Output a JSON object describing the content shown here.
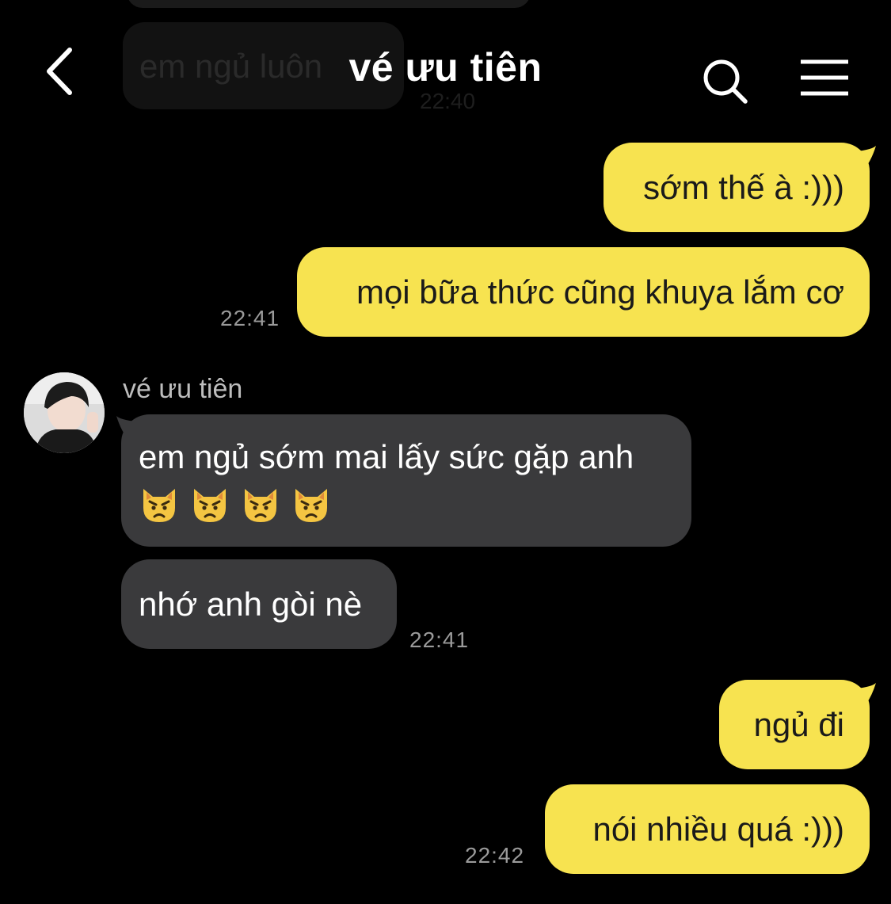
{
  "header": {
    "title": "vé ưu tiên",
    "back_icon": "chevron-left-icon",
    "search_icon": "search-icon",
    "menu_icon": "hamburger-menu-icon"
  },
  "ghost": {
    "text": "em ngủ luôn",
    "time": "22:40"
  },
  "contact": {
    "name": "vé ưu tiên"
  },
  "colors": {
    "mine_bubble": "#f7e350",
    "theirs_bubble": "#3a3a3c",
    "background": "#000000",
    "timestamp": "#9a9a9a"
  },
  "messages": [
    {
      "from": "me",
      "text": "sớm thế à :)))"
    },
    {
      "from": "me",
      "text": "mọi bữa thức cũng khuya lắm cơ",
      "time": "22:41"
    },
    {
      "from": "them",
      "text": "em ngủ sớm mai lấy sức gặp anh",
      "emoji": "pouting-cat-face",
      "emoji_count": 4
    },
    {
      "from": "them",
      "text": "nhớ anh gòi nè",
      "time": "22:41"
    },
    {
      "from": "me",
      "text": "ngủ đi"
    },
    {
      "from": "me",
      "text": "nói nhiều quá :)))",
      "time": "22:42"
    }
  ]
}
